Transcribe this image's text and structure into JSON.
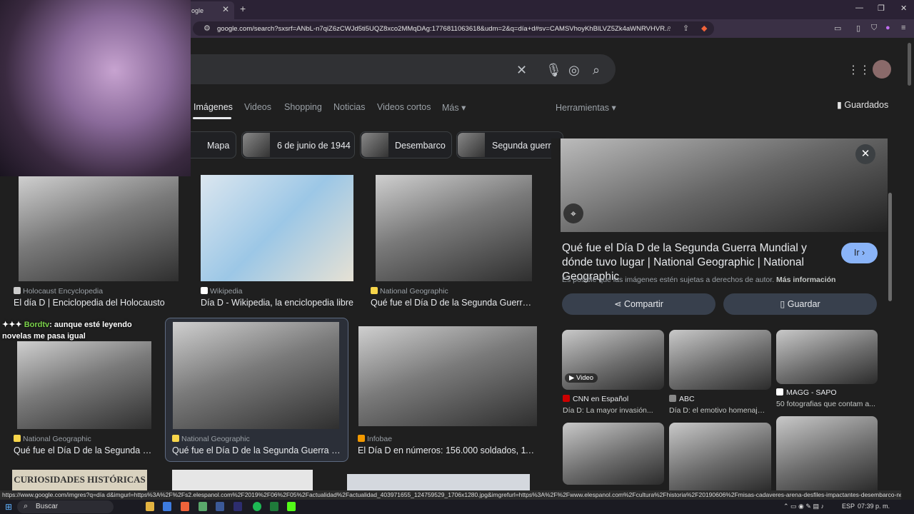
{
  "browser": {
    "tab_title": "ogle",
    "tab_close": "✕",
    "new_tab": "+",
    "url": "google.com/search?sxsrf=ANbL-n7qiZ6zCWJd5ti5UQZ8xco2MMqDAg:1776811063618&udm=2&q=día+d#sv=CAMSVhoyKhBlLVZ5Zk4aWNRVHVR...",
    "status_url": "https://www.google.com/imgres?q=día d&imgurl=https%3A%2F%2Fs2.elespanol.com%2F2019%2F06%2F05%2Factualidad%2Factualidad_403971655_124759529_1706x1280.jpg&imgrefurl=https%3A%2F%2Fwww.elespanol.com%2Fcultura%2Fhistoria%2F20190606%2Fmisas-cadaveres-arena-desfiles-impactantes-desembarco-normandia%2F403989604_..."
  },
  "nav": {
    "tabs": [
      "Imágenes",
      "Videos",
      "Shopping",
      "Noticias",
      "Videos cortos",
      "Más ▾"
    ],
    "tools": "Herramientas ▾",
    "saved": "Guardados"
  },
  "chips": [
    "Mapa",
    "6 de junio de 1944",
    "Desembarco",
    "Segunda guerra"
  ],
  "results": [
    {
      "source": "Holocaust Encyclopedia",
      "title": "El día D | Enciclopedia del Holocausto"
    },
    {
      "source": "Wikipedia",
      "title": "Día D - Wikipedia, la enciclopedia libre"
    },
    {
      "source": "National Geographic",
      "title": "Qué fue el Día D de la Segunda Guerra ..."
    },
    {
      "source": "National Geographic",
      "title": "Qué fue el Día D de la Segunda G..."
    },
    {
      "source": "National Geographic",
      "title": "Qué fue el Día D de la Segunda Guerra M..."
    },
    {
      "source": "Infobae",
      "title": "El Día D en números: 156.000 soldados, 11...."
    }
  ],
  "bottom_row": {
    "curiosidades": "CURIOSIDADES HISTÓRICAS"
  },
  "panel": {
    "close": "✕",
    "title": "Qué fue el Día D de la Segunda Guerra Mundial y dónde tuvo lugar | National Geographic | National Geographic",
    "go_button": "Ir ›",
    "copyright": "Es posible que las imágenes estén sujetas a derechos de autor.",
    "more_info": "Más información",
    "share": "Compartir",
    "save": "Guardar",
    "related": [
      {
        "source": "CNN en Español",
        "title": "Día D: La mayor invasión...",
        "badge": "▶ Video"
      },
      {
        "source": "ABC",
        "title": "Día D: el emotivo homenaje ..."
      },
      {
        "source": "MAGG - SAPO",
        "title": "50 fotografias que contam a..."
      }
    ]
  },
  "chat": {
    "user": "Bordtv",
    "message": ": aunque esté leyendo novelas me pasa igual"
  },
  "taskbar": {
    "search": "Buscar",
    "lang": "ESP",
    "time": "07:39 p. m."
  },
  "colors": {
    "accent": "#8ab4f8",
    "bg": "#1f1f1f",
    "chrome": "#3a3045"
  }
}
